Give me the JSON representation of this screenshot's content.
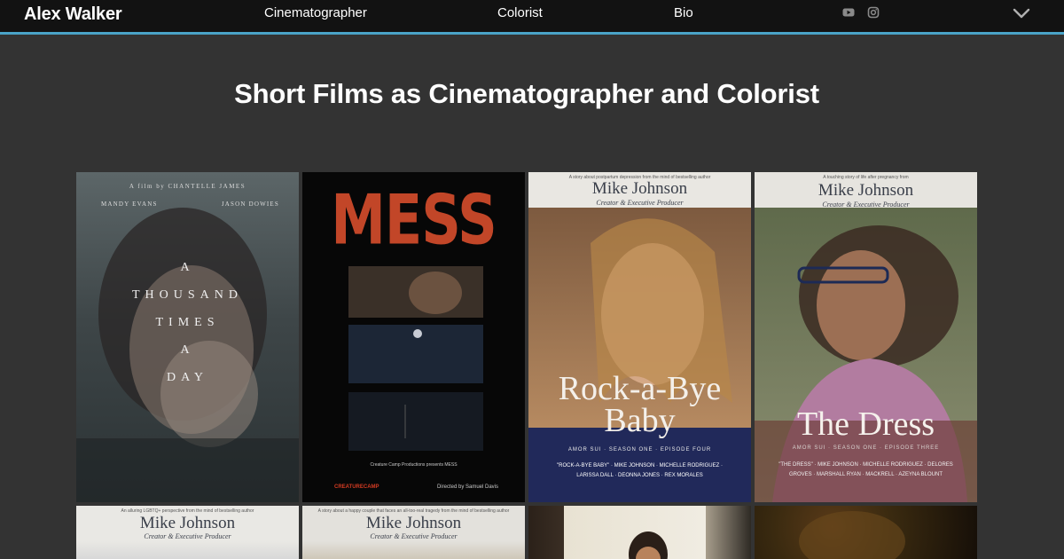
{
  "nav": {
    "brand": "Alex Walker",
    "links": [
      "Cinematographer",
      "Colorist",
      "Bio"
    ],
    "icons": [
      "youtube-icon",
      "instagram-icon",
      "chevron-down-icon"
    ]
  },
  "page": {
    "heading": "Short Films as Cinematographer and Colorist"
  },
  "posters": [
    {
      "credit": "A film by CHANTELLE JAMES",
      "actor_left": "MANDY EVANS",
      "actor_right": "JASON DOWIES",
      "title_lines": [
        "A",
        "THOUSAND",
        "TIMES",
        "A",
        "DAY"
      ]
    },
    {
      "title": "MESS",
      "credits": "Creature Camp Productions presents MESS",
      "studio": "CREATURECAMP",
      "directed": "Directed by Samuel Davis"
    },
    {
      "tagline": "A story about postpartum depression from the mind of bestselling author",
      "author": "Mike Johnson",
      "role": "Creator & Executive Producer",
      "title_line1": "Rock-a-Bye",
      "title_line2": "Baby",
      "episode": "AMOR SUI · SEASON ONE · EPISODE FOUR",
      "credits": "\"ROCK-A-BYE BABY\" · MIKE JOHNSON · MICHELLE RODRIGUEZ · LARISSA DALL · DEONNA JONES · REX MORALES"
    },
    {
      "tagline": "A touching story of life after pregnancy from",
      "author": "Mike Johnson",
      "role": "Creator & Executive Producer",
      "title": "The Dress",
      "episode": "AMOR SUI · SEASON ONE · EPISODE THREE",
      "credits": "\"THE DRESS\" · MIKE JOHNSON · MICHELLE RODRIGUEZ · DELORES GROVES · MARSHALL RYAN · MACKRELL · AZEYNA BLOUNT"
    },
    {
      "tagline": "An alluring LGBTQ+ perspective from the mind of bestselling author",
      "author": "Mike Johnson",
      "role": "Creator & Executive Producer"
    },
    {
      "tagline": "A story about a happy couple that faces an all-too-real tragedy from the mind of bestselling author",
      "author": "Mike Johnson",
      "role": "Creator & Executive Producer"
    },
    {},
    {}
  ]
}
